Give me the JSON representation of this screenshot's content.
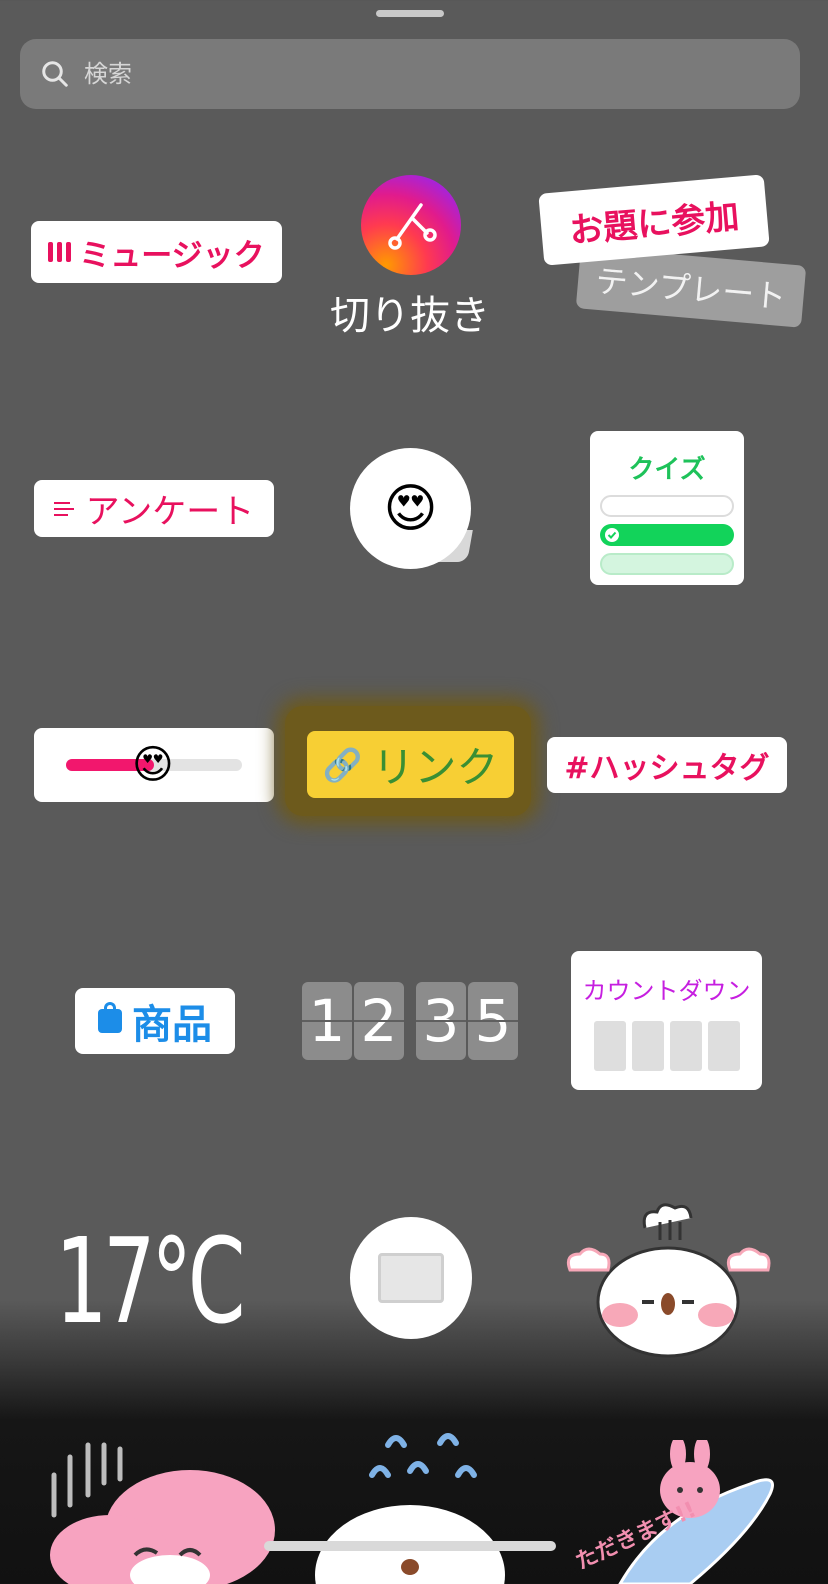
{
  "search": {
    "placeholder": "検索"
  },
  "stickers": {
    "music": "ミュージック",
    "cutout": "切り抜き",
    "challenge": "お題に参加",
    "template": "テンプレート",
    "poll": "アンケート",
    "emoji_question": "😍",
    "quiz": "クイズ",
    "slider_emoji": "😍",
    "link": "リンク",
    "hashtag": "#ハッシュタグ",
    "product": "商品",
    "clock": [
      "1",
      "2",
      "3",
      "5"
    ],
    "countdown": "カウントダウン",
    "temperature": "17°C",
    "bottom_sticker_text": "ただきます!!"
  },
  "colors": {
    "background": "#5a5a5a",
    "accent_pink": "#e8115e",
    "link_yellow": "#f7cf34",
    "link_green": "#3a8f33",
    "quiz_green": "#1ec25a",
    "product_blue": "#1c8de8",
    "countdown_purple": "#c61fe0"
  },
  "icons": {
    "search": "search-icon",
    "cutout": "scissors-icon",
    "link": "link-icon",
    "product": "shopping-bag-icon",
    "music": "music-bars-icon",
    "poll": "poll-lines-icon"
  }
}
